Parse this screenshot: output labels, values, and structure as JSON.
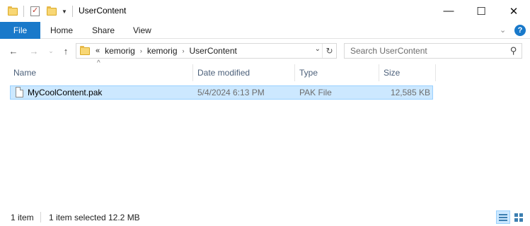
{
  "window": {
    "title": "UserContent",
    "controls": {
      "minimize": "—",
      "maximize": "☐",
      "close": "✕"
    }
  },
  "ribbon": {
    "tabs": [
      {
        "label": "File"
      },
      {
        "label": "Home"
      },
      {
        "label": "Share"
      },
      {
        "label": "View"
      }
    ],
    "accent": "#1979ca",
    "expand_icon": "chevron-down-icon",
    "help_label": "?"
  },
  "navigation": {
    "back_icon": "arrow-left-icon",
    "forward_icon": "arrow-right-icon",
    "recent_icon": "chevron-down-icon",
    "up_icon": "arrow-up-icon",
    "breadcrumb": {
      "overflow": "«",
      "items": [
        "kemorig",
        "kemorig",
        "UserContent"
      ]
    },
    "search": {
      "placeholder": "Search UserContent"
    }
  },
  "columns": [
    {
      "label": "Name"
    },
    {
      "label": "Date modified"
    },
    {
      "label": "Type"
    },
    {
      "label": "Size"
    }
  ],
  "files": [
    {
      "name": "MyCoolContent.pak",
      "date_modified": "5/4/2024 6:13 PM",
      "type": "PAK File",
      "size": "12,585 KB",
      "selected": true
    }
  ],
  "status": {
    "item_count": "1 item",
    "selection": "1 item selected",
    "selection_size": "12.2 MB",
    "view": "details"
  },
  "colors": {
    "selection_fill": "#cce8ff",
    "selection_border": "#99d1ff",
    "header_text": "#4c607a"
  }
}
